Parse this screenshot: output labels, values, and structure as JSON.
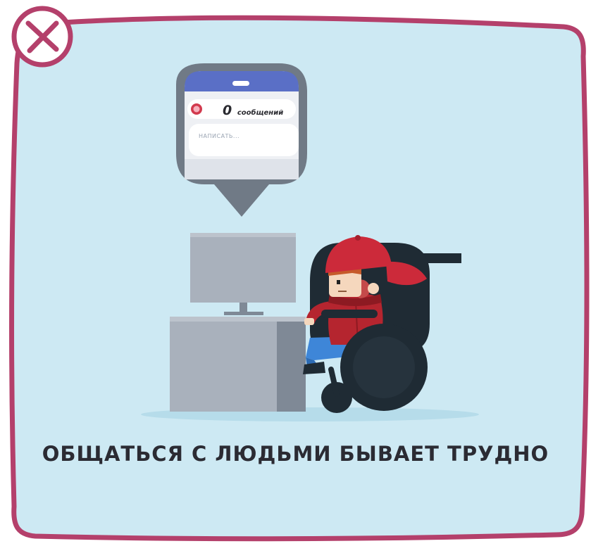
{
  "close_icon": {
    "name": "close-icon",
    "color": "#b4406b"
  },
  "message_bubble": {
    "count": "0",
    "count_label": "сообщений",
    "input_placeholder": "НАПИСАТЬ...",
    "header_color": "#5a6fc6"
  },
  "caption": "ОБЩАТЬСЯ С ЛЮДЬМИ БЫВАЕТ ТРУДНО",
  "colors": {
    "frame": "#b4406b",
    "background": "#cde9f3",
    "monitor": "#a9b1bc",
    "wheelchair": "#1f2b34",
    "cap": "#cc2a3a",
    "jacket": "#b5252f",
    "jeans": "#3e86d8"
  }
}
